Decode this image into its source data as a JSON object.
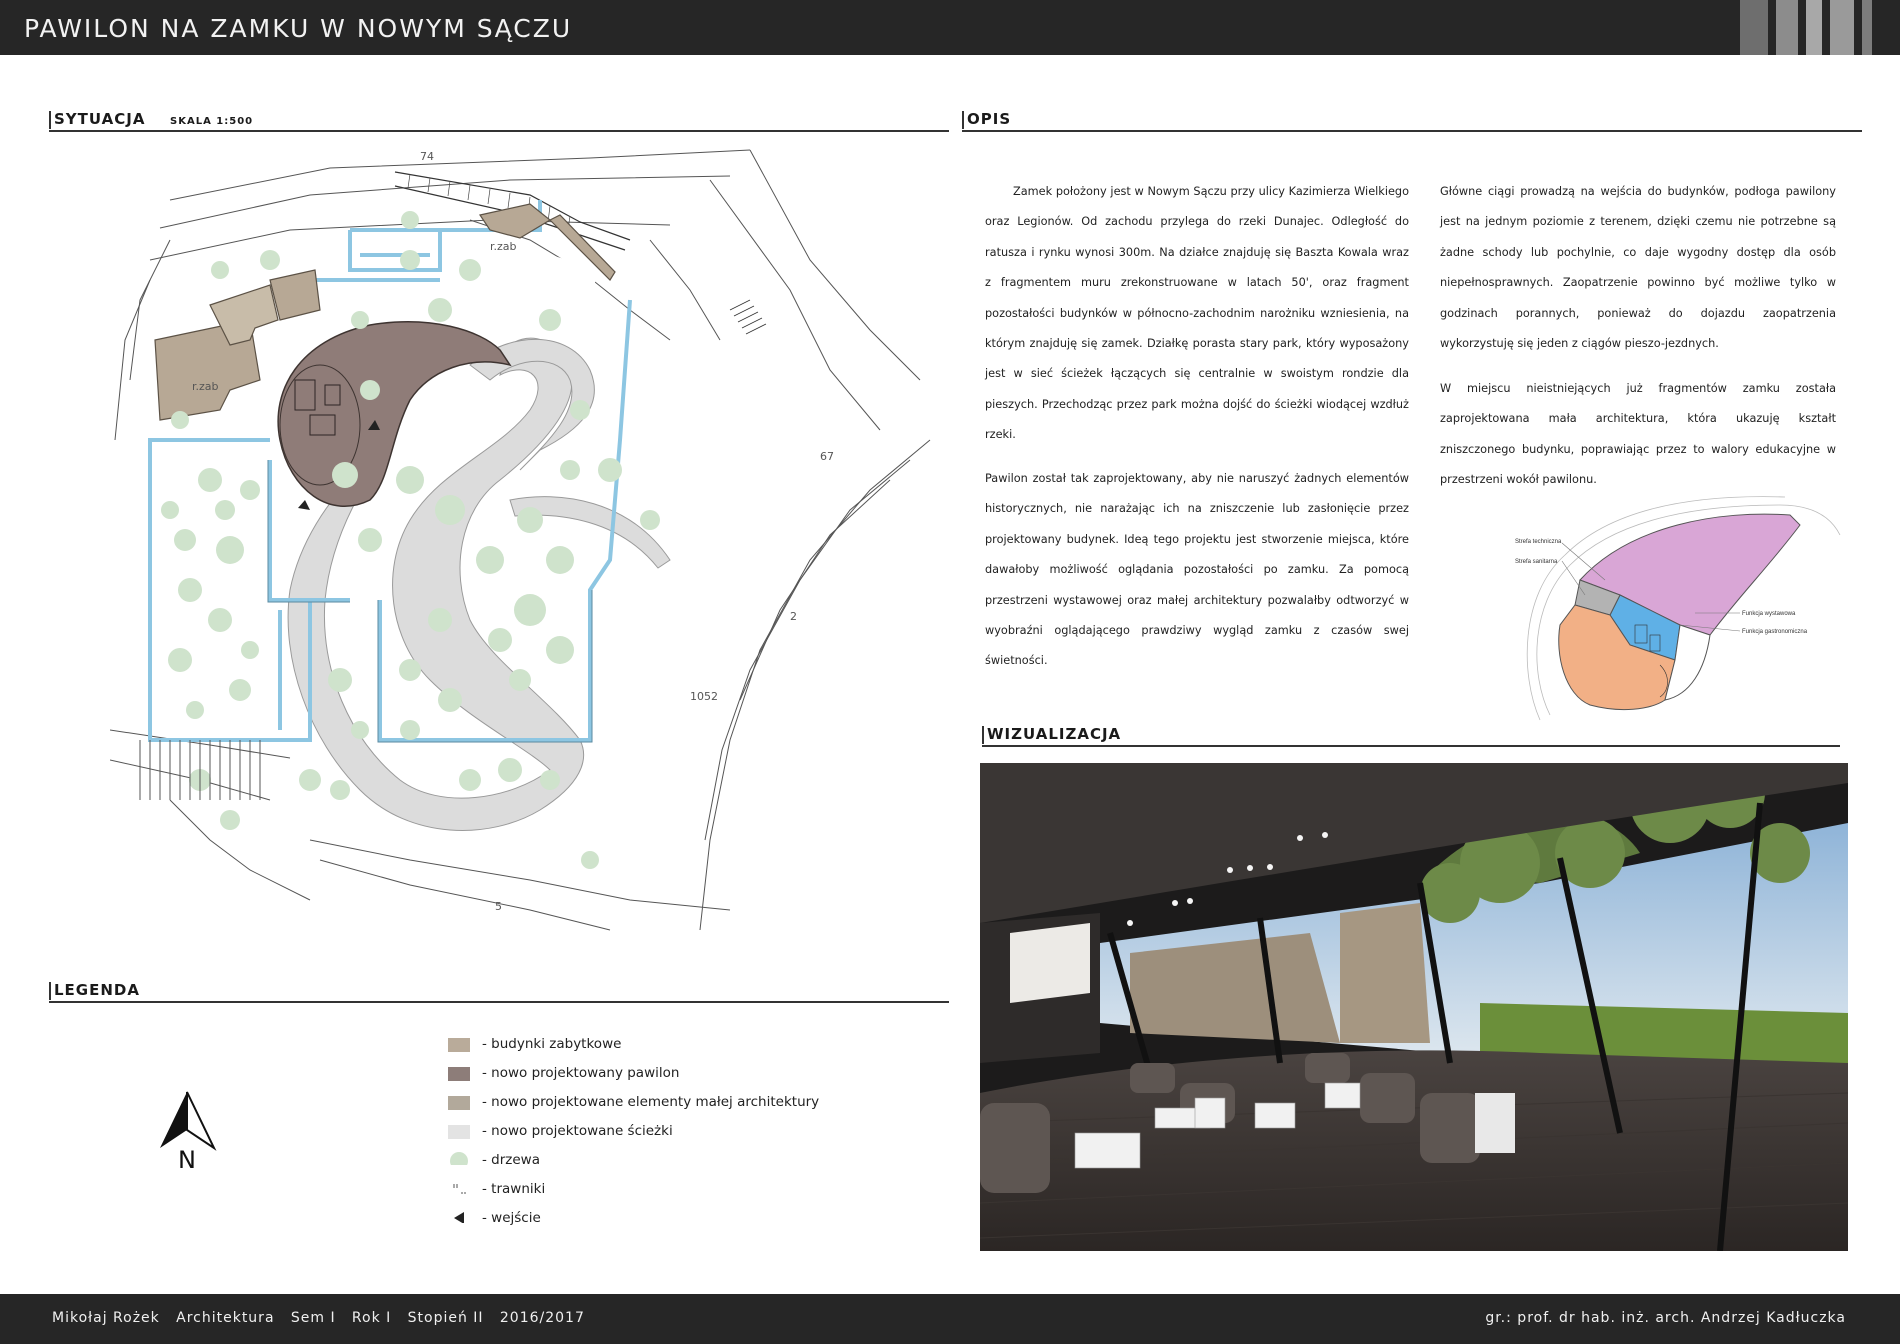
{
  "header": {
    "title": "Pawilon na zamku w Nowym Sączu"
  },
  "sections": {
    "sytuacja": "SYTUACJA",
    "skala": "SKALA 1:500",
    "opis": "OPIS",
    "wizualizacja": "WIZUALIZACJA",
    "legenda": "LEGENDA"
  },
  "site_plan": {
    "labels": {
      "rzab1": "r.zab",
      "rzab2": "r.zab",
      "n74": "74",
      "n67": "67",
      "n1052": "1052",
      "n5": "5",
      "n2": "2"
    },
    "colors": {
      "historic": "#b7a895",
      "pavilion": "#8f7c78",
      "paths": "#d9d9d9",
      "walls": "#8fc6e0",
      "trees": "#cfe3cc"
    }
  },
  "opis": {
    "col1": [
      "Zamek położony jest w Nowym Sączu przy ulicy Kazimierza Wielkiego oraz Legionów. Od zachodu przylega do rzeki Dunajec. Odległość do ratusza i rynku wynosi 300m. Na działce znajduję się Baszta Kowala wraz z fragmentem muru zrekonstruowane w latach 50', oraz fragment pozostałości budynków w północno-zachodnim narożniku wzniesienia, na którym znajduję się zamek. Działkę porasta stary park, który wyposażony jest w sieć ścieżek łączących się centralnie w swoistym rondzie dla pieszych. Przechodząc przez park można dojść do ścieżki wiodącej wzdłuż rzeki.",
      "Pawilon został tak zaprojektowany, aby nie naruszyć żadnych elementów historycznych, nie narażając ich na zniszczenie lub zasłonięcie przez projektowany budynek. Ideą tego projektu jest stworzenie miejsca, które dawałoby możliwość oglądania pozostałości po zamku. Za pomocą przestrzeni wystawowej oraz małej architektury pozwalałby odtworzyć w wyobraźni oglądającego prawdziwy wygląd zamku z czasów swej świetności."
    ],
    "col2": [
      "Główne ciągi prowadzą na wejścia do budynków, podłoga pawilony jest na jednym poziomie z terenem, dzięki czemu nie potrzebne są żadne schody lub pochylnie, co daje wygodny dostęp dla osób niepełnosprawnych. Zaopatrzenie powinno być możliwe tylko w godzinach porannych, ponieważ do dojazdu zaopatrzenia wykorzystuję się jeden z ciągów pieszo-jezdnych.",
      "W miejscu nieistniejących już fragmentów zamku została zaprojektowana mała architektura, która ukazuję kształt zniszczonego budynku, poprawiając przez to walory edukacyjne w przestrzeni wokół pawilonu."
    ]
  },
  "zones": {
    "labels": [
      "Strefa techniczna",
      "Strefa sanitarna",
      "Funkcja wystawowa",
      "Funkcja gastronomiczna"
    ],
    "colors": {
      "exhibit": "#d9a6d6",
      "gastro": "#f2b086",
      "sanitary": "#5fb0e6",
      "technical": "#b3b3b3"
    }
  },
  "legend": {
    "items": [
      {
        "label": "- budynki zabytkowe",
        "color": "#b9ab9a"
      },
      {
        "label": "- nowo projektowany pawilon",
        "color": "#8d7d79"
      },
      {
        "label": "- nowo projektowane elementy małej architektury",
        "color": "#b2a99b"
      },
      {
        "label": "- nowo projektowane ścieżki",
        "color": "#e3e3e3"
      },
      {
        "label": "- drzewa",
        "color": "#cfe3cc"
      },
      {
        "label": "- trawniki",
        "color": "#ffffff"
      },
      {
        "label": "- wejście",
        "color": "#333333"
      }
    ]
  },
  "north": {
    "label": "N"
  },
  "footer": {
    "left": "Mikołaj Rożek   Architektura   Sem I   Rok I   Stopień II   2016/2017",
    "right": "gr.: prof. dr hab. inż. arch. Andrzej Kadłuczka"
  }
}
